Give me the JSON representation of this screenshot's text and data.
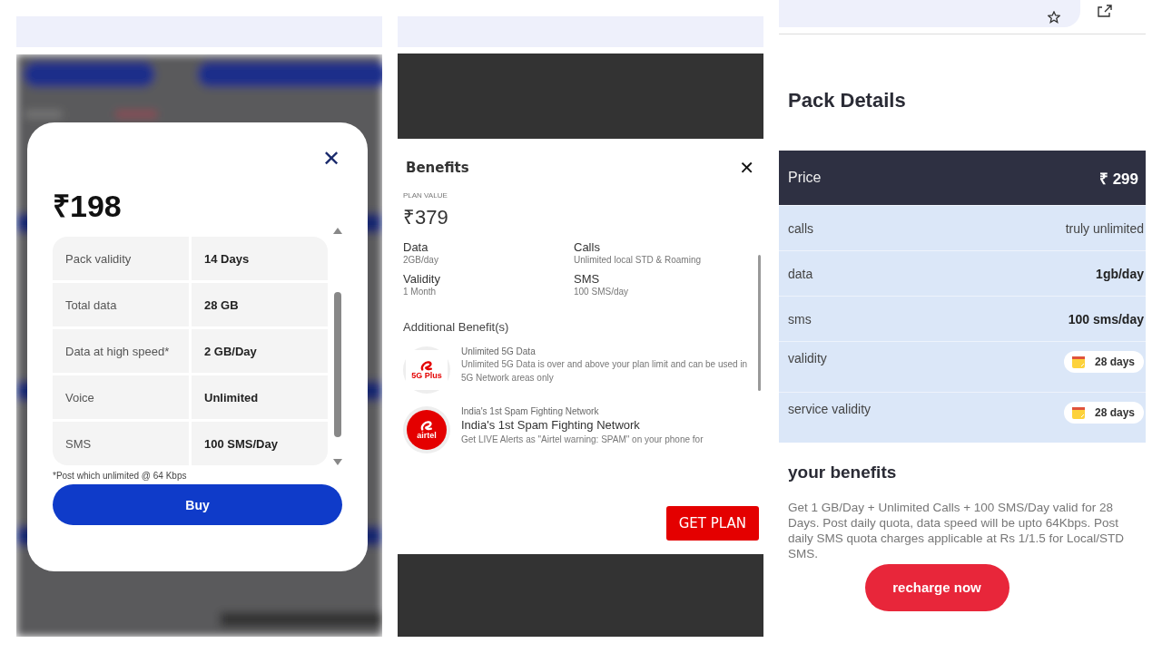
{
  "panels": [
    {
      "kind": "modal_sheet",
      "close": "✕",
      "price": "₹198",
      "rows": [
        {
          "label": "Pack validity",
          "value": "14 Days"
        },
        {
          "label": "Total data",
          "value": "28 GB"
        },
        {
          "label": "Data at high speed*",
          "value": "2 GB/Day"
        },
        {
          "label": "Voice",
          "value": "Unlimited"
        },
        {
          "label": "SMS",
          "value": "100 SMS/Day"
        }
      ],
      "footnote": "*Post which unlimited @ 64 Kbps",
      "button": "Buy"
    },
    {
      "kind": "benefits_dialog",
      "title": "Benefits",
      "close": "✕",
      "plan_value_label": "PLAN VALUE",
      "plan_value": "₹379",
      "benefits": [
        {
          "name": "Data",
          "value": "2GB/day"
        },
        {
          "name": "Calls",
          "value": "Unlimited local STD & Roaming"
        },
        {
          "name": "Validity",
          "value": "1 Month"
        },
        {
          "name": "SMS",
          "value": "100 SMS/day"
        }
      ],
      "additional_title": "Additional Benefit(s)",
      "additional": [
        {
          "badge": "5G Plus",
          "caption": "Unlimited 5G Data",
          "description": "Unlimited 5G Data is over and above your plan limit and can be used in 5G Network areas only"
        },
        {
          "badge": "airtel",
          "caption": "India's 1st Spam Fighting Network",
          "title": "India's 1st Spam Fighting Network",
          "description": "Get LIVE Alerts as \"Airtel warning: SPAM\" on your phone for"
        }
      ],
      "button": "GET PLAN"
    },
    {
      "kind": "pack_page",
      "heading": "Pack Details",
      "price_row": {
        "label": "Price",
        "value": "₹ 299"
      },
      "rows": [
        {
          "label": "calls",
          "value": "truly unlimited",
          "kind": "text"
        },
        {
          "label": "data",
          "value": "1gb/day",
          "kind": "bold"
        },
        {
          "label": "sms",
          "value": "100 sms/day",
          "kind": "bold"
        },
        {
          "label": "validity",
          "value": "28 days",
          "kind": "calendar"
        },
        {
          "label": "service validity",
          "value": "28 days",
          "kind": "calendar"
        }
      ],
      "benefits_heading": "your benefits",
      "benefits_text": "Get 1 GB/Day + Unlimited Calls + 100 SMS/Day valid for 28 Days. Post daily quota, data speed will be upto 64Kbps. Post daily SMS quota charges applicable at Rs 1/1.5 for Local/STD SMS.",
      "button": "recharge now"
    }
  ]
}
